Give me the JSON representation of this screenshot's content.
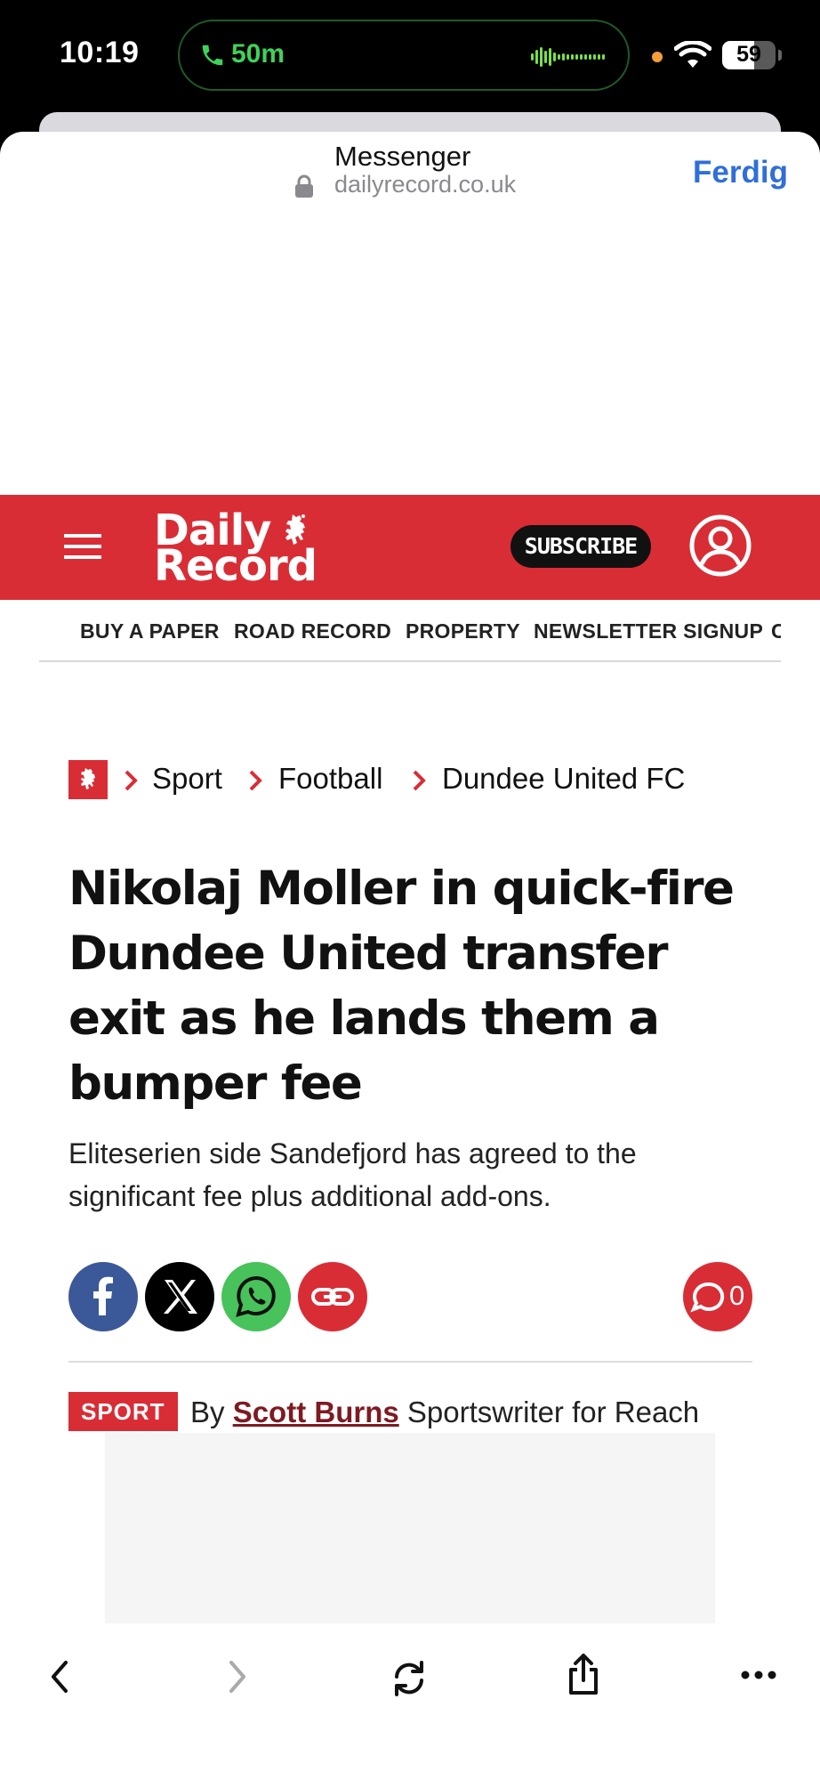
{
  "status_bar": {
    "time": "10:19",
    "call_duration": "50m",
    "battery": "59"
  },
  "sheet": {
    "app_title": "Messenger",
    "url": "dailyrecord.co.uk",
    "done_label": "Ferdig"
  },
  "site": {
    "logo_line1": "Daily",
    "logo_line2": "Record",
    "subscribe_label": "SUBSCRIBE",
    "brand_color": "#d92d36"
  },
  "nav": {
    "items": [
      "BUY A PAPER",
      "ROAD RECORD",
      "PROPERTY",
      "NEWSLETTER SIGNUP",
      "C"
    ]
  },
  "breadcrumb": {
    "items": [
      "Sport",
      "Football",
      "Dundee United FC"
    ]
  },
  "article": {
    "headline": "Nikolaj Moller in quick-fire Dundee United transfer exit as he lands them a bumper fee",
    "standfirst": "Eliteserien side Sandefjord has agreed to the significant fee plus additional add-ons.",
    "comment_count": "0",
    "section_tag": "SPORT",
    "byline_prefix": "By",
    "author": "Scott Burns",
    "author_role": "Sportswriter for Reach"
  },
  "share": {
    "icons": [
      "facebook-icon",
      "x-icon",
      "whatsapp-icon",
      "link-icon"
    ]
  },
  "toolbar": {
    "icons": [
      "back-icon",
      "forward-icon",
      "reload-icon",
      "share-icon",
      "more-icon"
    ]
  }
}
